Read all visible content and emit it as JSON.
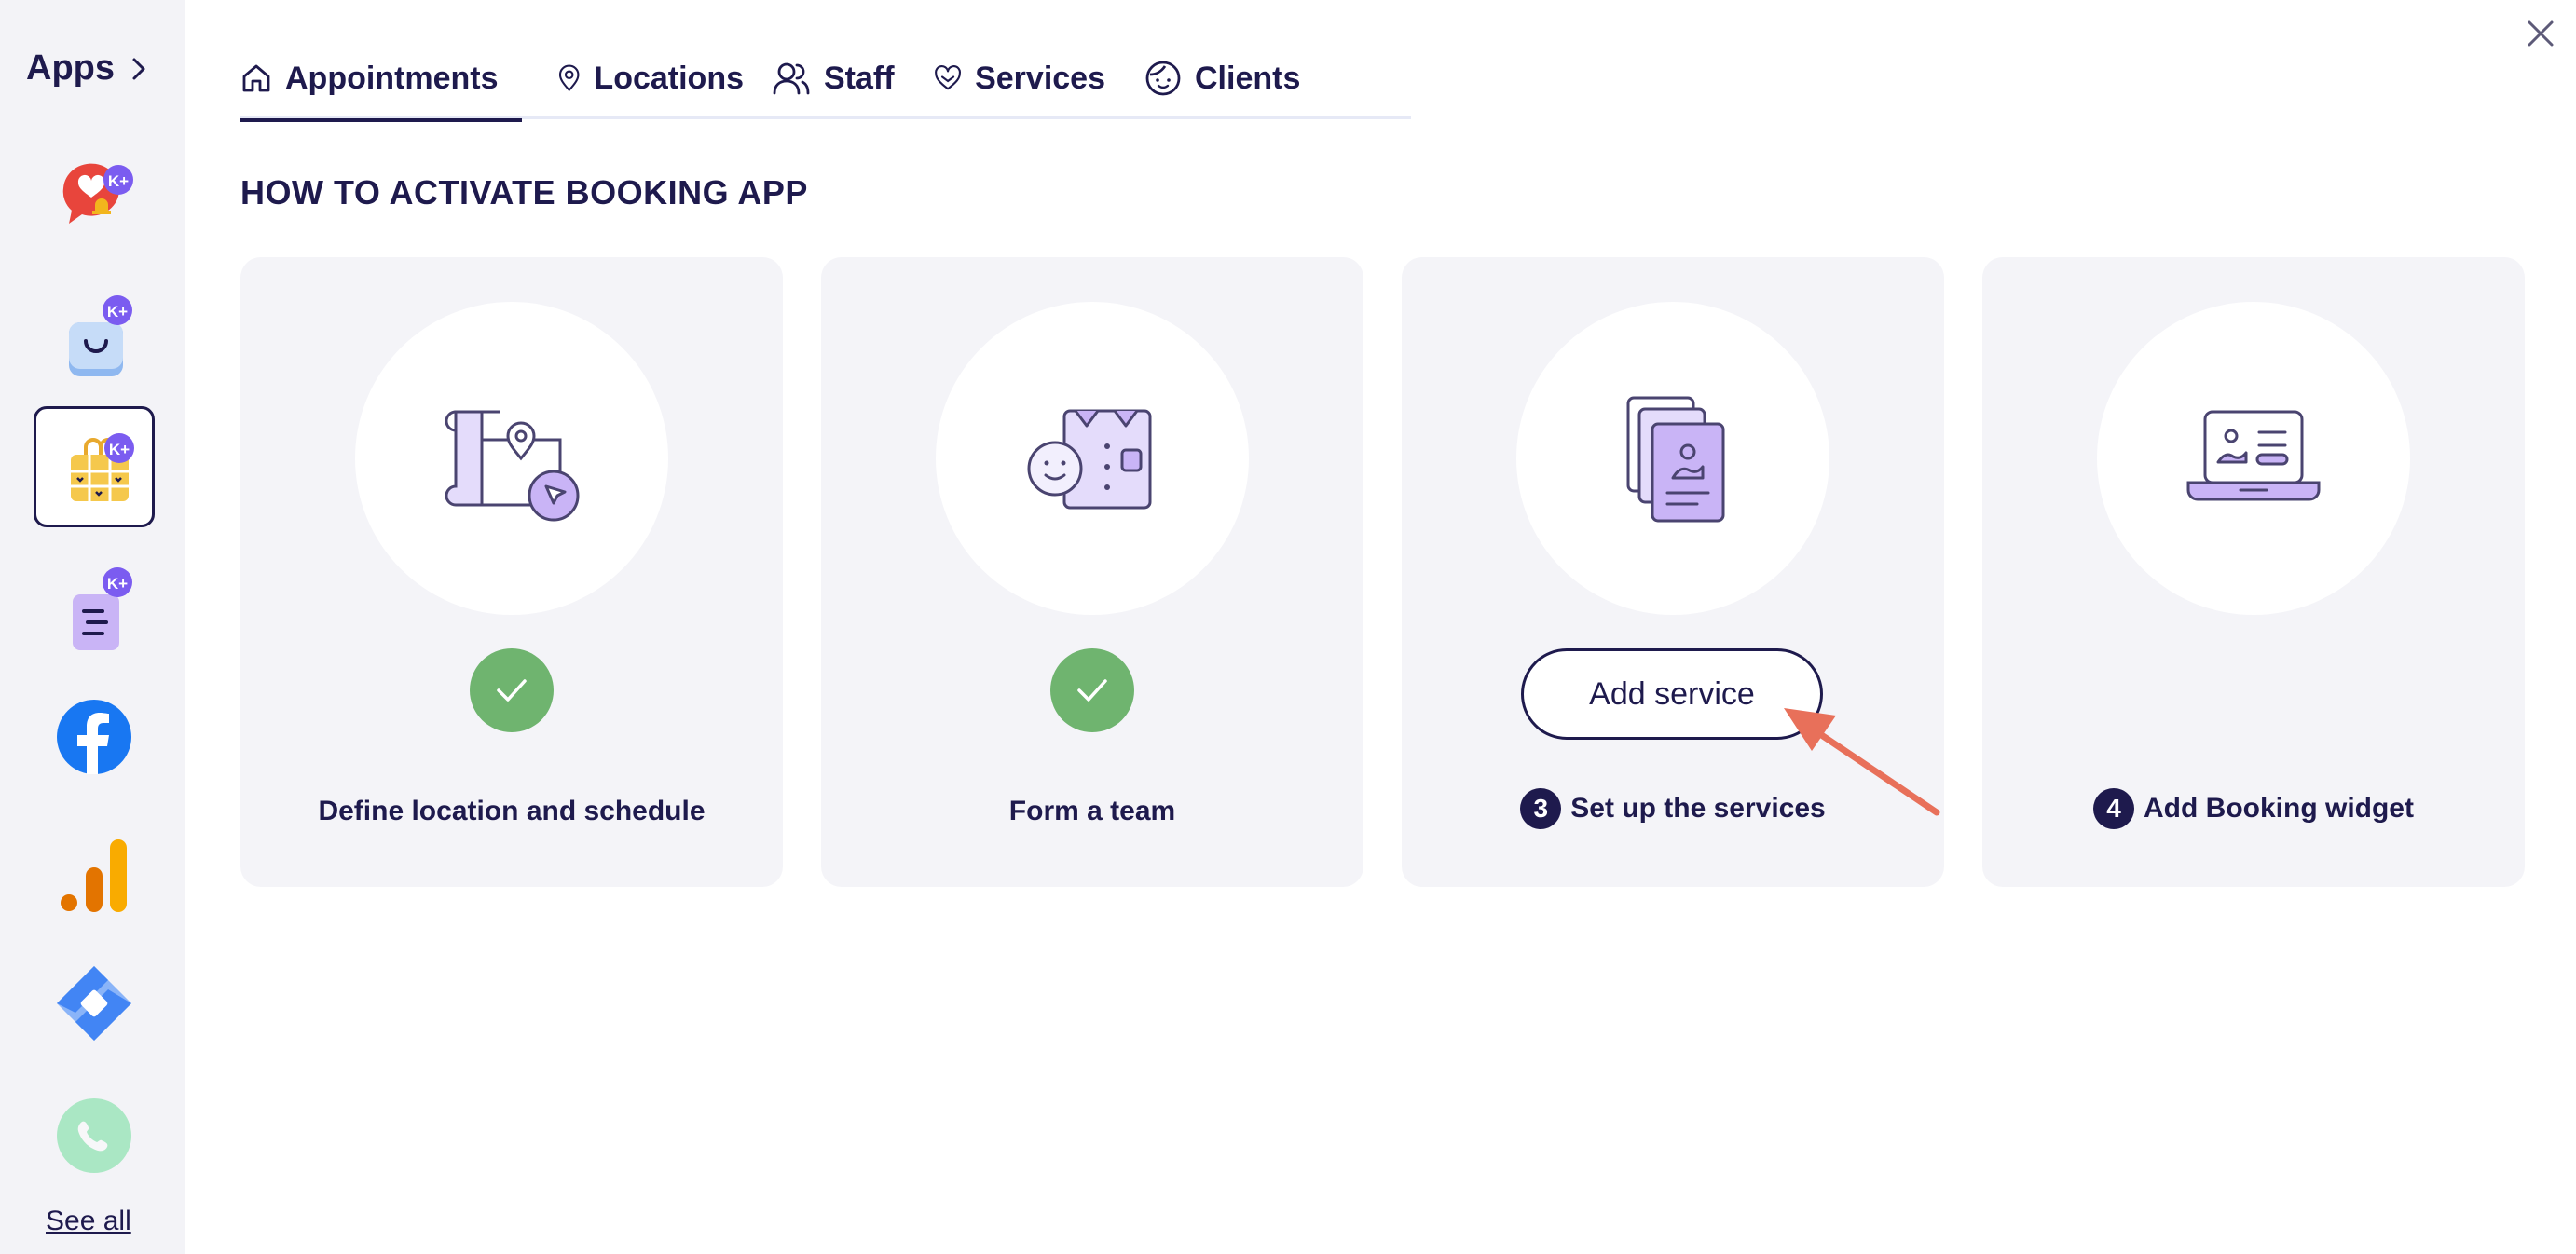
{
  "sidebar": {
    "title": "Apps",
    "see_all": "See all",
    "apps": [
      {
        "icon": "chat-heart-icon",
        "badge": "K+"
      },
      {
        "icon": "shopping-bag-icon",
        "badge": "K+"
      },
      {
        "icon": "booking-calendar-icon",
        "badge": "K+",
        "active": true
      },
      {
        "icon": "form-document-icon",
        "badge": "K+"
      },
      {
        "icon": "facebook-icon"
      },
      {
        "icon": "google-analytics-icon"
      },
      {
        "icon": "google-tag-manager-icon"
      },
      {
        "icon": "whatsapp-icon"
      }
    ]
  },
  "tabs": [
    {
      "label": "Appointments",
      "icon": "home-icon",
      "active": true
    },
    {
      "label": "Locations",
      "icon": "map-pin-icon"
    },
    {
      "label": "Staff",
      "icon": "users-icon"
    },
    {
      "label": "Services",
      "icon": "heart-hand-icon"
    },
    {
      "label": "Clients",
      "icon": "face-icon"
    }
  ],
  "main": {
    "title": "HOW TO ACTIVATE BOOKING APP",
    "steps": [
      {
        "label": "Define location and schedule",
        "status": "done",
        "icon": "map-location-icon"
      },
      {
        "label": "Form a team",
        "status": "done",
        "icon": "team-shirt-icon"
      },
      {
        "number": "3",
        "label": "Set up the services",
        "status": "current",
        "button": "Add service",
        "icon": "service-documents-icon"
      },
      {
        "number": "4",
        "label": "Add Booking widget",
        "status": "pending",
        "icon": "laptop-widget-icon"
      }
    ]
  },
  "colors": {
    "primary": "#1e1a4d",
    "accent_purple": "#7b5cf0",
    "success": "#6fb46f",
    "card_bg": "#f4f4f8",
    "arrow": "#e8705a"
  }
}
